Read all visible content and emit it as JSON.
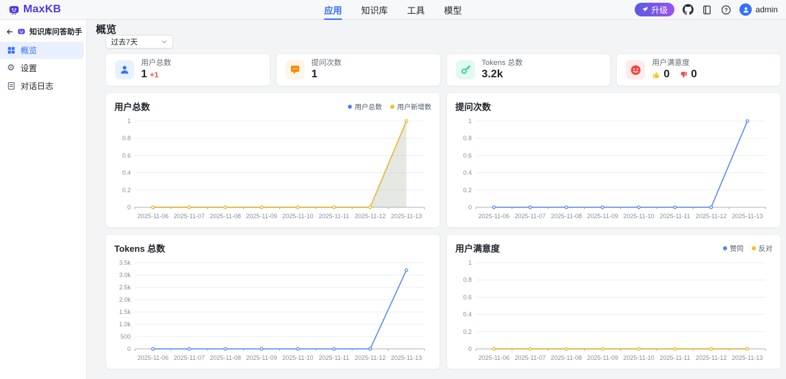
{
  "navbar": {
    "logo_text": "MaxKB",
    "tabs": [
      {
        "label": "应用",
        "active": true
      },
      {
        "label": "知识库",
        "active": false
      },
      {
        "label": "工具",
        "active": false
      },
      {
        "label": "模型",
        "active": false
      }
    ],
    "upgrade_label": "升级",
    "icons": [
      "rocket-icon",
      "github-icon",
      "docs-icon",
      "help-icon"
    ],
    "username": "admin"
  },
  "sidebar": {
    "app_title": "知识库问答助手",
    "items": [
      {
        "label": "概览",
        "icon": "grid-icon",
        "active": true
      },
      {
        "label": "设置",
        "icon": "gear-icon",
        "active": false
      },
      {
        "label": "对话日志",
        "icon": "log-icon",
        "active": false
      }
    ]
  },
  "page": {
    "title": "概览"
  },
  "filter": {
    "value": "过去7天"
  },
  "stats": [
    {
      "label": "用户总数",
      "value": "1",
      "delta": "+1",
      "icon": "user-icon",
      "icon_color": "#3370ff",
      "icon_bg": "#e8f1ff"
    },
    {
      "label": "提问次数",
      "value": "1",
      "icon": "chat-icon",
      "icon_color": "#ff8800",
      "icon_bg": "#fff5e8"
    },
    {
      "label": "Tokens 总数",
      "value": "3.2k",
      "icon": "key-icon",
      "icon_color": "#36cfa2",
      "icon_bg": "#e3f9f2"
    },
    {
      "label": "用户满意度",
      "like": "0",
      "dislike": "0",
      "icon": "smiley-icon",
      "icon_color": "#f0483e",
      "icon_bg": "#fdecec",
      "like_color": "#ffc60a",
      "dislike_color": "#f54a45"
    }
  ],
  "colors": {
    "accent": "#3370ff",
    "chart_blue": "#4e83fd",
    "chart_yellow": "#f7ba1e",
    "delta_red": "#f54a45"
  },
  "chart_data": [
    {
      "type": "area",
      "title": "用户总数",
      "x": [
        "2025-11-06",
        "2025-11-07",
        "2025-11-08",
        "2025-11-09",
        "2025-11-10",
        "2025-11-11",
        "2025-11-12",
        "2025-11-13"
      ],
      "series": [
        {
          "name": "用户总数",
          "color": "#4e83fd",
          "values": [
            0,
            0,
            0,
            0,
            0,
            0,
            0,
            1
          ],
          "area": false
        },
        {
          "name": "用户新增数",
          "color": "#f7ba1e",
          "values": [
            0,
            0,
            0,
            0,
            0,
            0,
            0,
            1
          ],
          "area": true,
          "area_color": "rgba(166,171,156,0.28)"
        }
      ],
      "ylim": [
        0,
        1
      ],
      "yticks": [
        0,
        0.2,
        0.4,
        0.6,
        0.8,
        1
      ],
      "ytick_labels": [
        "0",
        "0.2",
        "0.4",
        "0.6",
        "0.8",
        "1"
      ],
      "grid": true,
      "legend_show": true,
      "legend_position": "top-right"
    },
    {
      "type": "line",
      "title": "提问次数",
      "x": [
        "2025-11-06",
        "2025-11-07",
        "2025-11-08",
        "2025-11-09",
        "2025-11-10",
        "2025-11-11",
        "2025-11-12",
        "2025-11-13"
      ],
      "series": [
        {
          "name": "提问次数",
          "color": "#4e83fd",
          "values": [
            0,
            0,
            0,
            0,
            0,
            0,
            0,
            1
          ],
          "area": false
        }
      ],
      "ylim": [
        0,
        1
      ],
      "yticks": [
        0,
        0.2,
        0.4,
        0.6,
        0.8,
        1
      ],
      "ytick_labels": [
        "0",
        "0.2",
        "0.4",
        "0.6",
        "0.8",
        "1"
      ],
      "grid": true,
      "legend_show": false
    },
    {
      "type": "line",
      "title": "Tokens 总数",
      "x": [
        "2025-11-06",
        "2025-11-07",
        "2025-11-08",
        "2025-11-09",
        "2025-11-10",
        "2025-11-11",
        "2025-11-12",
        "2025-11-13"
      ],
      "series": [
        {
          "name": "Tokens 总数",
          "color": "#4e83fd",
          "values": [
            0,
            0,
            0,
            0,
            0,
            0,
            0,
            3200
          ],
          "area": false
        }
      ],
      "ylim": [
        0,
        3500
      ],
      "yticks": [
        0,
        500,
        1000,
        1500,
        2000,
        2500,
        3000,
        3500
      ],
      "ytick_labels": [
        "0",
        "500",
        "1.0k",
        "1.5k",
        "2.0k",
        "2.5k",
        "3.0k",
        "3.5k"
      ],
      "grid": true,
      "legend_show": false
    },
    {
      "type": "line",
      "title": "用户满意度",
      "x": [
        "2025-11-06",
        "2025-11-07",
        "2025-11-08",
        "2025-11-09",
        "2025-11-10",
        "2025-11-11",
        "2025-11-12",
        "2025-11-13"
      ],
      "series": [
        {
          "name": "赞同",
          "color": "#4e83fd",
          "values": [
            0,
            0,
            0,
            0,
            0,
            0,
            0,
            0
          ],
          "area": false
        },
        {
          "name": "反对",
          "color": "#f7ba1e",
          "values": [
            0,
            0,
            0,
            0,
            0,
            0,
            0,
            0
          ],
          "area": false
        }
      ],
      "ylim": [
        0,
        1
      ],
      "yticks": [
        0,
        0.2,
        0.4,
        0.6,
        0.8,
        1
      ],
      "ytick_labels": [
        "0",
        "0.2",
        "0.4",
        "0.6",
        "0.8",
        "1"
      ],
      "grid": true,
      "legend_show": true,
      "legend_position": "top-right"
    }
  ]
}
